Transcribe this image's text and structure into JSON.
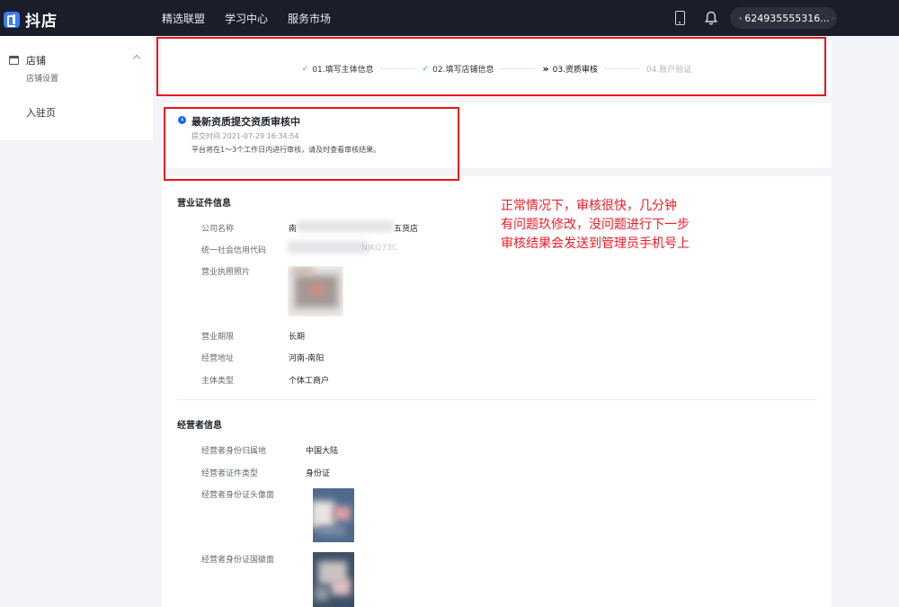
{
  "topbar": {
    "logo_text": "抖店",
    "nav": [
      "精选联盟",
      "学习中心",
      "服务市场"
    ],
    "user_id": "624935555316...",
    "icons": [
      "phone-icon",
      "bell-icon",
      "user-icon",
      "chevron-down-icon"
    ]
  },
  "sidebar": {
    "group_label": "店铺",
    "group_sub": "店铺设置",
    "item2": "入驻页",
    "icons": [
      "store-icon",
      "chevron-up-icon"
    ]
  },
  "steps": [
    {
      "label": "01.填写主体信息",
      "state": "done",
      "mark": "✓"
    },
    {
      "label": "02.填写店铺信息",
      "state": "done",
      "mark": "✓"
    },
    {
      "label": "03.资质审核",
      "state": "current",
      "mark": "»"
    },
    {
      "label": "04.账户验证",
      "state": "todo",
      "mark": ""
    }
  ],
  "status": {
    "title": "最新资质提交资质审核中",
    "time": "提交时间 2021-07-29 16:34:54",
    "desc": "平台将在1～3个工作日内进行审核，请及时查看审核结果。"
  },
  "business": {
    "title": "营业证件信息",
    "company_label": "公司名称",
    "company_value_start": "南",
    "company_value_end": "五货店",
    "credit_label": "统一社会信用代码",
    "credit_value_end": "NJKQ73C",
    "license_label": "营业执照照片",
    "term_label": "营业期限",
    "term_value": "长期",
    "address_label": "经营地址",
    "address_value": "河南-南阳",
    "type_label": "主体类型",
    "type_value": "个体工商户"
  },
  "operator": {
    "title": "经营者信息",
    "region_label": "经营者身份归属地",
    "region_value": "中国大陆",
    "doc_label": "经营者证件类型",
    "doc_value": "身份证",
    "front_label": "经营者身份证头像面",
    "back_label": "经营者身份证国徽面"
  },
  "annotation": {
    "color": "#e8141d",
    "lines": [
      "正常情况下，审核很快，几分钟",
      "有问题玖修改，没问题进行下一步",
      "审核结果会发送到管理员手机号上"
    ]
  }
}
